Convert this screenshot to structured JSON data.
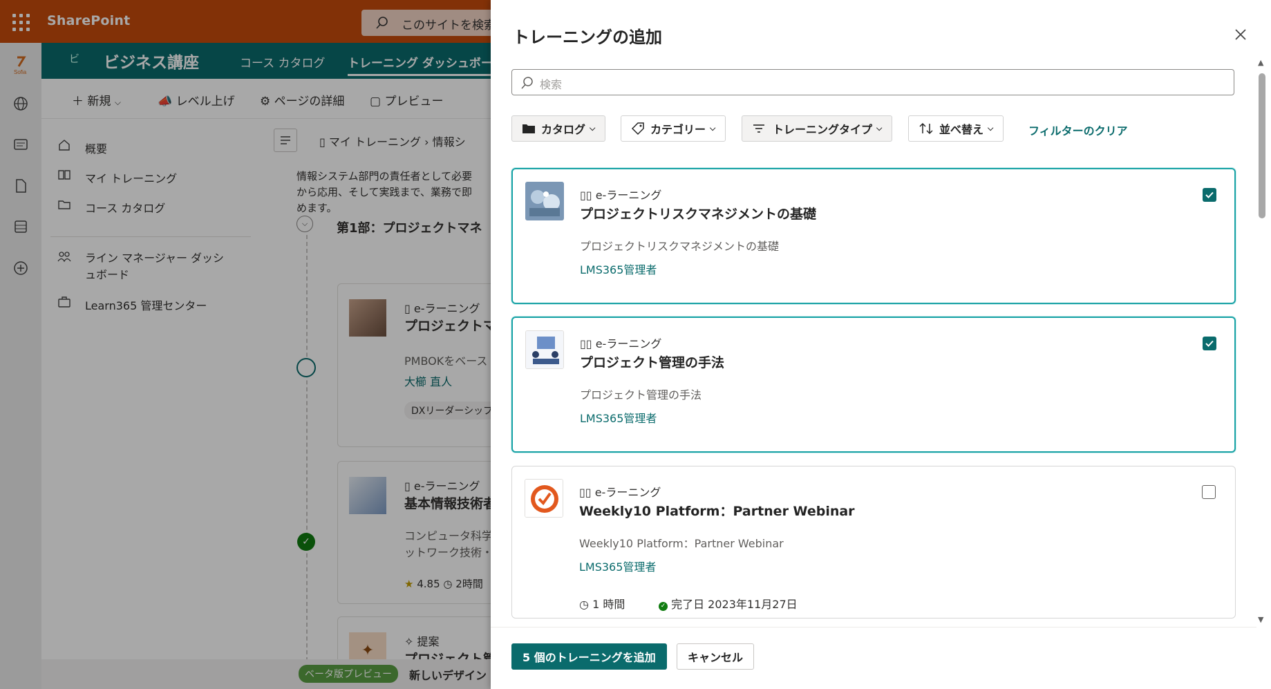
{
  "header": {
    "app_name": "SharePoint",
    "search_placeholder": "このサイトを検索"
  },
  "site": {
    "logo_text": "ビ",
    "name": "ビジネス講座",
    "nav": [
      "コース カタログ",
      "トレーニング ダッシュボード"
    ]
  },
  "command_bar": {
    "new": "新規",
    "level_up": "レベル上げ",
    "page_details": "ページの詳細",
    "preview": "プレビュー"
  },
  "left_nav": {
    "items": [
      "概要",
      "マイ トレーニング",
      "コース カタログ"
    ],
    "manager": [
      "ライン マネージャー ダッシ",
      "ュボード"
    ],
    "admin": "Learn365 管理センター"
  },
  "background": {
    "breadcrumb": [
      "マイ トレーニング",
      "情報シ"
    ],
    "intro": [
      "情報システム部門の責任者として必要",
      "から応用、そして実践まで、業務で即",
      "めます。"
    ],
    "section_title": "第1部：プロジェクトマネ",
    "items": [
      {
        "type": "e-ラーニング",
        "title": "プロジェクトマ",
        "desc": "PMBOKをベース",
        "author": "大櫛 直人",
        "tag": "DXリーダーシップ"
      },
      {
        "type": "e-ラーニング",
        "title": "基本情報技術者",
        "desc1": "コンピュータ科学",
        "desc2": "ットワーク技術・",
        "rating": "4.85",
        "duration": "2時間"
      },
      {
        "type": "提案",
        "title": "プロジェクト管"
      }
    ],
    "beta_badge": "ベータ版プレビュー",
    "beta_text": "新しいデザイン"
  },
  "panel": {
    "title": "トレーニングの追加",
    "search_placeholder": "検索",
    "filters": {
      "catalog": "カタログ",
      "category": "カテゴリー",
      "training_type": "トレーニングタイプ",
      "sort": "並べ替え",
      "clear": "フィルターのクリア"
    },
    "cards": [
      {
        "type": "e-ラーニング",
        "title": "プロジェクトリスクマネジメントの基礎",
        "desc": "プロジェクトリスクマネジメントの基礎",
        "author": "LMS365管理者",
        "checked": true
      },
      {
        "type": "e-ラーニング",
        "title": "プロジェクト管理の手法",
        "desc": "プロジェクト管理の手法",
        "author": "LMS365管理者",
        "checked": true
      },
      {
        "type": "e-ラーニング",
        "title": "Weekly10 Platform：Partner Webinar",
        "desc": "Weekly10 Platform：Partner Webinar",
        "author": "LMS365管理者",
        "checked": false,
        "duration": "1 時間",
        "completed": "完了日 2023年11月27日"
      }
    ],
    "footer": {
      "add": "5 個のトレーニングを追加",
      "cancel": "キャンセル"
    }
  },
  "colors": {
    "topbar": "#c64b0c",
    "site_bar": "#0a6b6c",
    "accent": "#0a6b6c",
    "selected_border": "#17a2a5"
  }
}
